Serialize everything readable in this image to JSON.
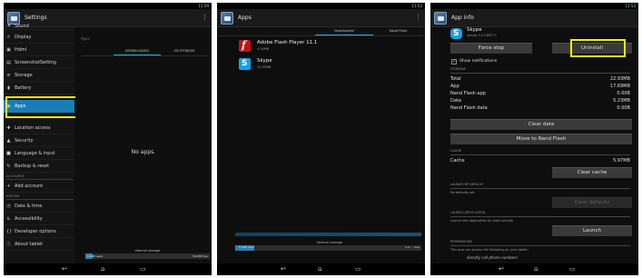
{
  "status": {
    "panel1_time": "11:59",
    "panel2_time": "11:52",
    "panel3_time": "11:53"
  },
  "panel1": {
    "title": "Settings",
    "sidebar": {
      "items": [
        {
          "label": "Sound",
          "icon": "speaker-icon"
        },
        {
          "label": "Display",
          "icon": "display-icon"
        },
        {
          "label": "Hdmi",
          "icon": "hdmi-icon"
        },
        {
          "label": "ScreenshotSetting",
          "icon": "screenshot-icon"
        },
        {
          "label": "Storage",
          "icon": "storage-icon"
        },
        {
          "label": "Battery",
          "icon": "battery-icon"
        },
        {
          "label": "Apps",
          "icon": "apps-icon",
          "selected": true
        },
        {
          "label": "Location access",
          "icon": "location-icon"
        },
        {
          "label": "Security",
          "icon": "lock-icon"
        },
        {
          "label": "Language & input",
          "icon": "keyboard-icon"
        },
        {
          "label": "Backup & reset",
          "icon": "backup-icon"
        },
        {
          "label": "Add account",
          "icon": "plus-icon"
        },
        {
          "label": "Date & time",
          "icon": "clock-icon"
        },
        {
          "label": "Accessibility",
          "icon": "accessibility-icon"
        },
        {
          "label": "Developer options",
          "icon": "braces-icon"
        },
        {
          "label": "About tablet",
          "icon": "info-icon"
        }
      ],
      "headers": {
        "accounts": "ACCOUNTS",
        "system": "SYSTEM"
      }
    },
    "main": {
      "apps_label": "Apps",
      "tabs": [
        "DOWNLOADED",
        "ON STORAGE"
      ],
      "empty_message": "No apps.",
      "storage_title": "Internal storage",
      "storage_used": "0.00B used",
      "storage_free": "300MB free",
      "storage_fraction": 0.06
    }
  },
  "panel2": {
    "title": "Apps",
    "tabs": [
      "Downloaded",
      "Nand Flash"
    ],
    "apps": [
      {
        "name": "Adobe Flash Player 11.1",
        "size": "4.34MB",
        "icon": "flash-player-icon"
      },
      {
        "name": "Skype",
        "size": "22.93MB",
        "icon": "skype-icon"
      }
    ],
    "storage_title": "Internal storage",
    "storage_used": "0.00B used",
    "storage_free": "0.0 ... free",
    "storage_fraction": 0.1
  },
  "panel3": {
    "title": "App info",
    "app_name": "Skype",
    "app_version": "version 3.2.0.6677.1",
    "buttons": {
      "force_stop": "Force stop",
      "uninstall": "Uninstall",
      "clear_data": "Clear data",
      "move": "Move to Nand Flash",
      "clear_cache": "Clear cache",
      "clear_defaults": "Clear defaults",
      "launch": "Launch"
    },
    "show_notifications": "Show notifications",
    "headers": {
      "storage": "STORAGE",
      "cache": "CACHE",
      "launch_default": "LAUNCH BY DEFAULT",
      "launch_app": "LAUNCH APPLICATION",
      "permissions": "PERMISSIONS"
    },
    "storage_rows": [
      {
        "label": "Total",
        "value": "22.93MB"
      },
      {
        "label": "App",
        "value": "17.69MB"
      },
      {
        "label": "Nand Flash app",
        "value": "0.00B"
      },
      {
        "label": "Data",
        "value": "5.23MB"
      },
      {
        "label": "Nand Flash data",
        "value": "0.00B"
      }
    ],
    "cache_row": {
      "label": "Cache",
      "value": "5.97MB"
    },
    "no_defaults": "No defaults set.",
    "launch_desc": "Launch the application by main activity",
    "permissions_desc": "This app can access the following on your tablet:",
    "permission_item": "directly call phone numbers"
  },
  "nav": {
    "back": "↩",
    "home": "⌂",
    "recent": "▭"
  }
}
